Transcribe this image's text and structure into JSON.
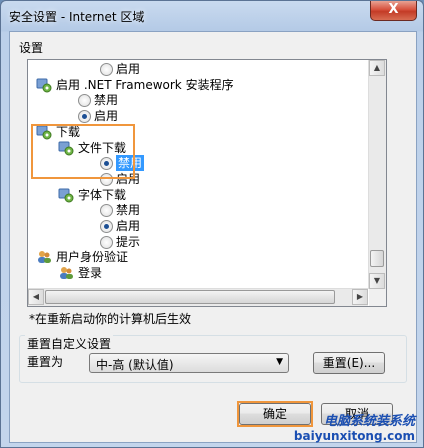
{
  "window": {
    "title": "安全设置 - Internet 区域",
    "close_label": "X"
  },
  "settings": {
    "label": "设置"
  },
  "tree_rows": [
    {
      "kind": "radio",
      "checked": false,
      "indent": 2,
      "text": "启用"
    },
    {
      "kind": "group",
      "indent": 0,
      "icon": "settings-gear-icon",
      "text": "启用 .NET Framework 安装程序"
    },
    {
      "kind": "radio",
      "checked": false,
      "indent": 1,
      "text": "禁用"
    },
    {
      "kind": "radio",
      "checked": true,
      "indent": 1,
      "text": "启用"
    },
    {
      "kind": "group",
      "indent": 0,
      "icon": "settings-gear-icon",
      "text": "下载"
    },
    {
      "kind": "group",
      "indent": 1,
      "icon": "settings-gear-icon",
      "text": "文件下载"
    },
    {
      "kind": "radio",
      "checked": true,
      "indent": 2,
      "text": "禁用",
      "selected": true
    },
    {
      "kind": "radio",
      "checked": false,
      "indent": 2,
      "text": "启用"
    },
    {
      "kind": "group",
      "indent": 1,
      "icon": "settings-gear-icon",
      "text": "字体下载"
    },
    {
      "kind": "radio",
      "checked": false,
      "indent": 2,
      "text": "禁用"
    },
    {
      "kind": "radio",
      "checked": true,
      "indent": 2,
      "text": "启用"
    },
    {
      "kind": "radio",
      "checked": false,
      "indent": 2,
      "text": "提示"
    },
    {
      "kind": "group",
      "indent": 0,
      "icon": "users-icon",
      "text": "用户身份验证"
    },
    {
      "kind": "group",
      "indent": 1,
      "icon": "users-icon",
      "text": "登录"
    }
  ],
  "note": "*在重新启动你的计算机后生效",
  "reset": {
    "group_title": "重置自定义设置",
    "label": "重置为",
    "value": "中-高 (默认值)",
    "button": "重置(E)..."
  },
  "footer": {
    "ok": "确定",
    "cancel": "取消"
  },
  "watermark": {
    "line1": "电脑系统装系统",
    "line2": "baiyunxitong.com"
  },
  "colors": {
    "highlight": "#f0963c",
    "selection": "#3399ff"
  }
}
